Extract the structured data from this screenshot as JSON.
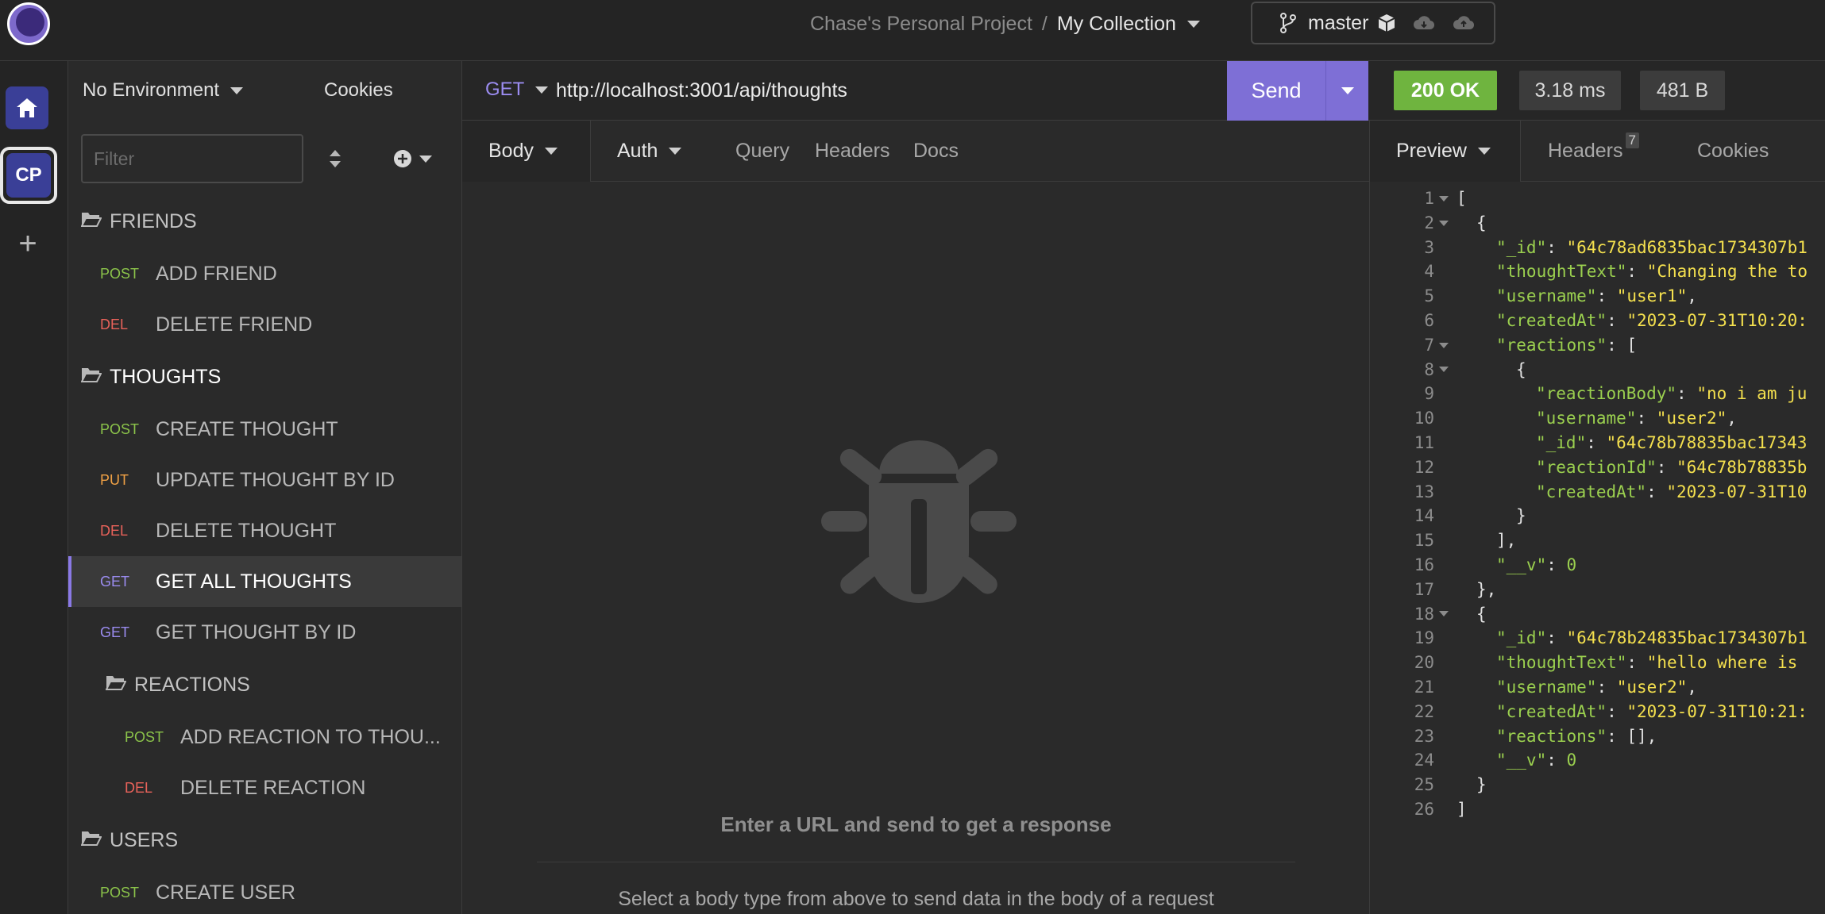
{
  "topbar": {
    "project": "Chase's Personal Project",
    "separator": "/",
    "collection": "My Collection",
    "branch": "master"
  },
  "rail": {
    "workspace_initials": "CP",
    "add_label": "+"
  },
  "sidebar": {
    "environment": "No Environment",
    "cookies": "Cookies",
    "filter_placeholder": "Filter",
    "tree": [
      {
        "type": "folder",
        "name": "FRIENDS"
      },
      {
        "type": "request",
        "method": "POST",
        "name": "ADD FRIEND"
      },
      {
        "type": "request",
        "method": "DEL",
        "name": "DELETE FRIEND"
      },
      {
        "type": "folder",
        "name": "THOUGHTS"
      },
      {
        "type": "request",
        "method": "POST",
        "name": "CREATE THOUGHT"
      },
      {
        "type": "request",
        "method": "PUT",
        "name": "UPDATE THOUGHT BY ID"
      },
      {
        "type": "request",
        "method": "DEL",
        "name": "DELETE THOUGHT"
      },
      {
        "type": "request",
        "method": "GET",
        "name": "GET ALL THOUGHTS",
        "active": true
      },
      {
        "type": "request",
        "method": "GET",
        "name": "GET THOUGHT BY ID"
      },
      {
        "type": "folder",
        "name": "REACTIONS"
      },
      {
        "type": "request",
        "method": "POST",
        "name": "ADD REACTION TO THOU..."
      },
      {
        "type": "request",
        "method": "DEL",
        "name": "DELETE REACTION"
      },
      {
        "type": "folder",
        "name": "USERS"
      },
      {
        "type": "request",
        "method": "POST",
        "name": "CREATE USER"
      }
    ]
  },
  "request": {
    "method": "GET",
    "url": "http://localhost:3001/api/thoughts",
    "send_label": "Send",
    "tabs": {
      "body": "Body",
      "auth": "Auth",
      "query": "Query",
      "headers": "Headers",
      "docs": "Docs"
    },
    "empty_title": "Enter a URL and send to get a response",
    "empty_sub": "Select a body type from above to send data in the body of a request"
  },
  "response": {
    "status": "200 OK",
    "time": "3.18 ms",
    "size": "481 B",
    "tabs": {
      "preview": "Preview",
      "headers": "Headers",
      "headers_count": "7",
      "cookies": "Cookies"
    },
    "lines": [
      {
        "n": "1",
        "fold": true,
        "indent": 0,
        "text": "["
      },
      {
        "n": "2",
        "fold": true,
        "indent": 1,
        "text": "{"
      },
      {
        "n": "3",
        "indent": 2,
        "key": "\"_id\"",
        "val": "\"64c78ad6835bac1734307b1",
        "vtype": "s"
      },
      {
        "n": "4",
        "indent": 2,
        "key": "\"thoughtText\"",
        "val": "\"Changing the to",
        "vtype": "s"
      },
      {
        "n": "5",
        "indent": 2,
        "key": "\"username\"",
        "val": "\"user1\"",
        "vtype": "s",
        "tail": ","
      },
      {
        "n": "6",
        "indent": 2,
        "key": "\"createdAt\"",
        "val": "\"2023-07-31T10:20:",
        "vtype": "s"
      },
      {
        "n": "7",
        "fold": true,
        "indent": 2,
        "key": "\"reactions\"",
        "val": "[",
        "vtype": "p"
      },
      {
        "n": "8",
        "fold": true,
        "indent": 3,
        "text": "{"
      },
      {
        "n": "9",
        "indent": 4,
        "key": "\"reactionBody\"",
        "val": "\"no i am ju",
        "vtype": "s"
      },
      {
        "n": "10",
        "indent": 4,
        "key": "\"username\"",
        "val": "\"user2\"",
        "vtype": "s",
        "tail": ","
      },
      {
        "n": "11",
        "indent": 4,
        "key": "\"_id\"",
        "val": "\"64c78b78835bac17343",
        "vtype": "s"
      },
      {
        "n": "12",
        "indent": 4,
        "key": "\"reactionId\"",
        "val": "\"64c78b78835b",
        "vtype": "s"
      },
      {
        "n": "13",
        "indent": 4,
        "key": "\"createdAt\"",
        "val": "\"2023-07-31T10",
        "vtype": "s"
      },
      {
        "n": "14",
        "indent": 3,
        "text": "}"
      },
      {
        "n": "15",
        "indent": 2,
        "text": "],"
      },
      {
        "n": "16",
        "indent": 2,
        "key": "\"__v\"",
        "val": "0",
        "vtype": "n"
      },
      {
        "n": "17",
        "indent": 1,
        "text": "},"
      },
      {
        "n": "18",
        "fold": true,
        "indent": 1,
        "text": "{"
      },
      {
        "n": "19",
        "indent": 2,
        "key": "\"_id\"",
        "val": "\"64c78b24835bac1734307b1",
        "vtype": "s"
      },
      {
        "n": "20",
        "indent": 2,
        "key": "\"thoughtText\"",
        "val": "\"hello where is",
        "vtype": "s"
      },
      {
        "n": "21",
        "indent": 2,
        "key": "\"username\"",
        "val": "\"user2\"",
        "vtype": "s",
        "tail": ","
      },
      {
        "n": "22",
        "indent": 2,
        "key": "\"createdAt\"",
        "val": "\"2023-07-31T10:21:",
        "vtype": "s"
      },
      {
        "n": "23",
        "indent": 2,
        "key": "\"reactions\"",
        "val": "[]",
        "vtype": "p",
        "tail": ","
      },
      {
        "n": "24",
        "indent": 2,
        "key": "\"__v\"",
        "val": "0",
        "vtype": "n"
      },
      {
        "n": "25",
        "indent": 1,
        "text": "}"
      },
      {
        "n": "26",
        "indent": 0,
        "text": "]"
      }
    ]
  },
  "colors": {
    "accent": "#7e6fd6",
    "status_ok": "#6fb43f",
    "post": "#8bc34a",
    "del": "#e8625a",
    "put": "#f0a145",
    "get": "#9b8cf0",
    "json_key": "#9bd04f",
    "json_string": "#f4e04e"
  },
  "icons": {
    "logo": "insomnia-logo-icon",
    "branch": "git-branch-icon",
    "home": "home-icon",
    "folder": "folder-icon",
    "bug": "bug-icon"
  }
}
